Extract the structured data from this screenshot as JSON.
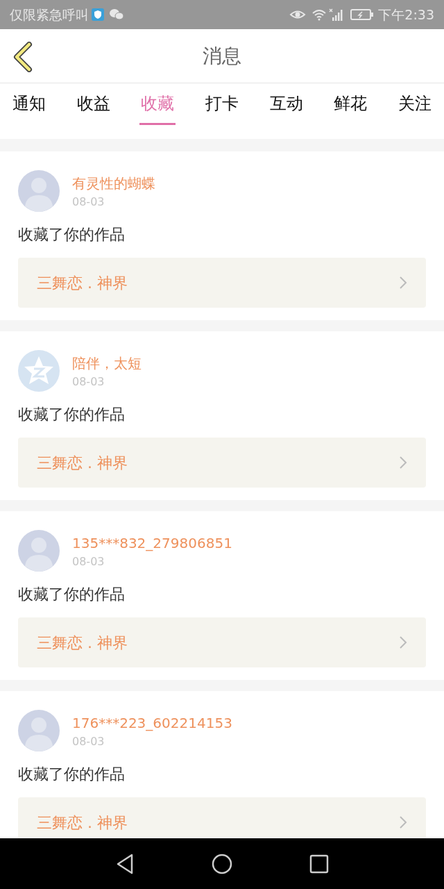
{
  "status_bar": {
    "carrier_text": "仅限紧急呼叫",
    "time": "下午2:33"
  },
  "header": {
    "title": "消息"
  },
  "tabs": [
    {
      "label": "通知",
      "selected": false
    },
    {
      "label": "收益",
      "selected": false
    },
    {
      "label": "收藏",
      "selected": true
    },
    {
      "label": "打卡",
      "selected": false
    },
    {
      "label": "互动",
      "selected": false
    },
    {
      "label": "鲜花",
      "selected": false
    },
    {
      "label": "关注",
      "selected": false
    }
  ],
  "messages": [
    {
      "avatar": {
        "kind": "default"
      },
      "user": "有灵性的蝴蝶",
      "date": "08-03",
      "text": "收藏了你的作品",
      "work": "三舞恋 . 神界"
    },
    {
      "avatar": {
        "kind": "star"
      },
      "user": "陪伴，太短",
      "date": "08-03",
      "text": "收藏了你的作品",
      "work": "三舞恋 . 神界"
    },
    {
      "avatar": {
        "kind": "default"
      },
      "user": "135***832_279806851",
      "date": "08-03",
      "text": "收藏了你的作品",
      "work": "三舞恋 . 神界"
    },
    {
      "avatar": {
        "kind": "default"
      },
      "user": "176***223_602214153",
      "date": "08-03",
      "text": "收藏了你的作品",
      "work": "三舞恋 . 神界"
    }
  ]
}
